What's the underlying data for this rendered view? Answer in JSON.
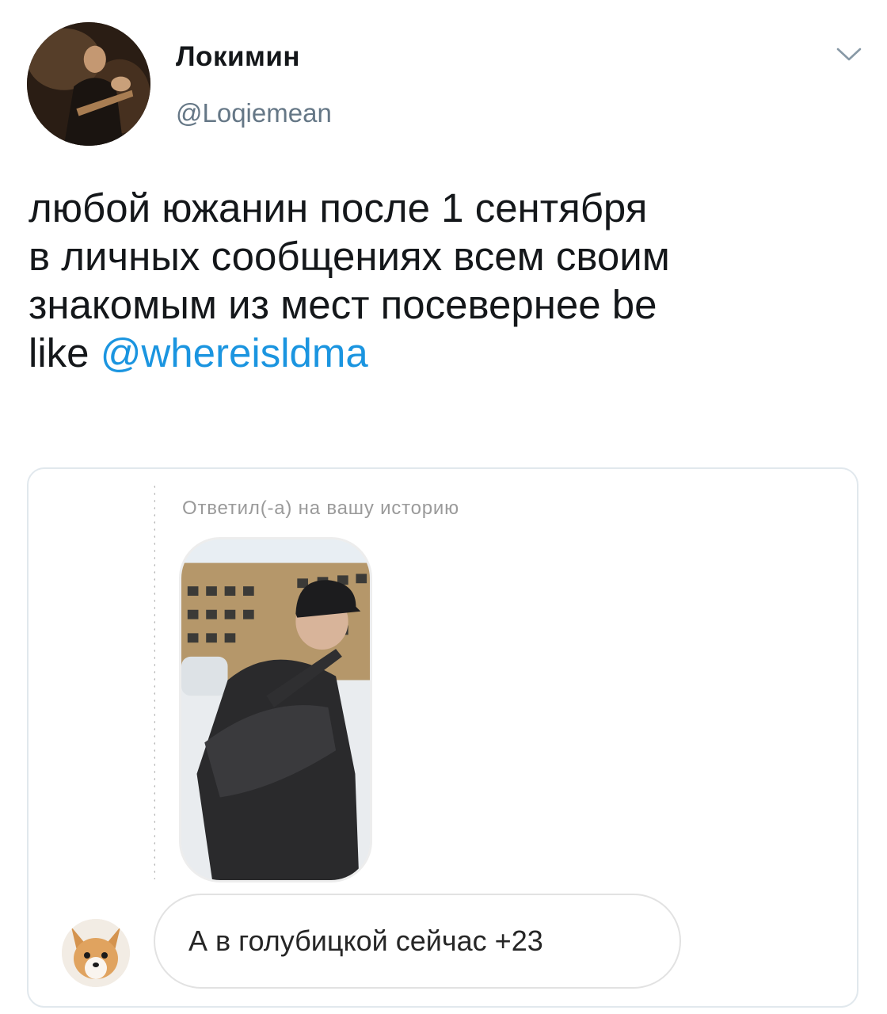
{
  "tweet": {
    "author": {
      "display_name": "Локимин",
      "handle": "@Loqiemean"
    },
    "text_lines": [
      "любой южанин после 1 сентября",
      "в личных сообщениях всем своим",
      "знакомым из мест посевернее be",
      "like "
    ],
    "mention": "@whereisldma",
    "menu_icon": "chevron-down-icon"
  },
  "embedded_dm": {
    "reply_note": "Ответил(-а) на вашу историю",
    "message": "А в голубицкой сейчас +23"
  },
  "colors": {
    "mention": "#1b95e0",
    "handle": "#657786",
    "border": "#e1e8ed"
  }
}
